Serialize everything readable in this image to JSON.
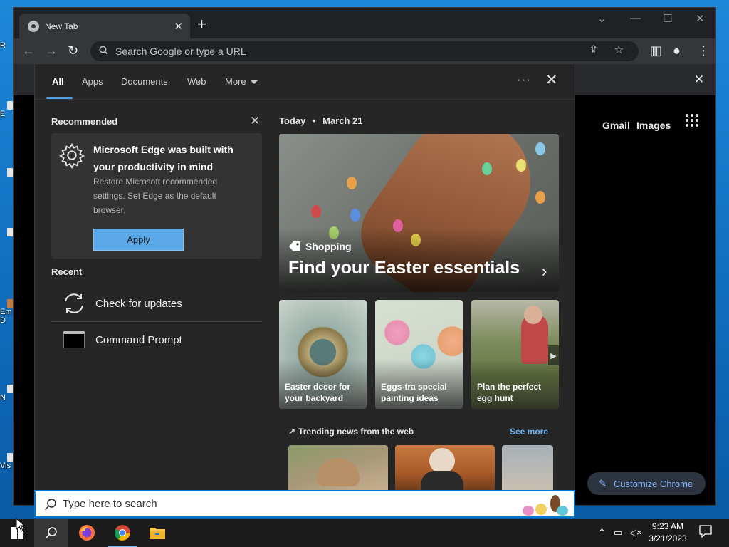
{
  "browser": {
    "tab_title": "New Tab",
    "omnibox_placeholder": "Search Google or type a URL",
    "ntp_links": [
      "Gmail",
      "Images"
    ],
    "customize_label": "Customize Chrome"
  },
  "search_panel": {
    "tabs": [
      "All",
      "Apps",
      "Documents",
      "Web",
      "More"
    ],
    "ellipsis": "···",
    "recommended": {
      "heading": "Recommended",
      "title": "Microsoft Edge was built with your productivity in mind",
      "body": "Restore Microsoft recommended settings. Set Edge as the default browser.",
      "apply_label": "Apply"
    },
    "recent": {
      "heading": "Recent",
      "items": [
        {
          "label": "Check for updates",
          "icon": "refresh-icon"
        },
        {
          "label": "Command Prompt",
          "icon": "command-prompt-icon"
        }
      ]
    },
    "today": {
      "label": "Today",
      "separator": "•",
      "date": "March 21"
    },
    "hero": {
      "tag": "Shopping",
      "title": "Find your Easter essentials"
    },
    "cards": [
      {
        "title": "Easter decor for your backyard"
      },
      {
        "title": "Eggs-tra special painting ideas"
      },
      {
        "title": "Plan the perfect egg hunt"
      }
    ],
    "trending": {
      "heading": "Trending news from the web",
      "see_more": "See more"
    }
  },
  "searchbox": {
    "placeholder": "Type here to search"
  },
  "taskbar": {
    "time": "9:23 AM",
    "date": "3/21/2023"
  },
  "colors": {
    "accent": "#0078d4",
    "link": "#6fb3f0",
    "apply_button": "#5aa8e8",
    "panel_bg": "#262626"
  }
}
